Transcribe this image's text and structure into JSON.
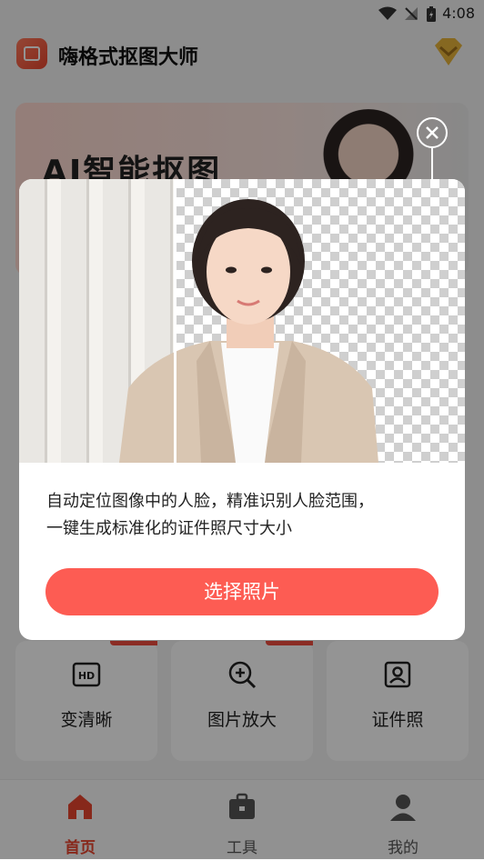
{
  "status_bar": {
    "time": "4:08"
  },
  "header": {
    "title": "嗨格式抠图大师"
  },
  "banner": {
    "title": "AI智能抠图"
  },
  "tools": [
    {
      "label": "变清晰",
      "icon": "hd-icon"
    },
    {
      "label": "图片放大",
      "icon": "zoom-in-icon"
    },
    {
      "label": "证件照",
      "icon": "id-photo-icon"
    }
  ],
  "nav": [
    {
      "label": "首页",
      "icon": "home-icon",
      "active": true
    },
    {
      "label": "工具",
      "icon": "toolbox-icon",
      "active": false
    },
    {
      "label": "我的",
      "icon": "profile-icon",
      "active": false
    }
  ],
  "modal": {
    "description_line1": "自动定位图像中的人脸，精准识别人脸范围，",
    "description_line2": "一键生成标准化的证件照尺寸大小",
    "button_label": "选择照片"
  },
  "colors": {
    "accent": "#fd5c53",
    "brand": "#e9462f",
    "nav_active": "#e9462f",
    "nav_inactive": "#555555"
  }
}
